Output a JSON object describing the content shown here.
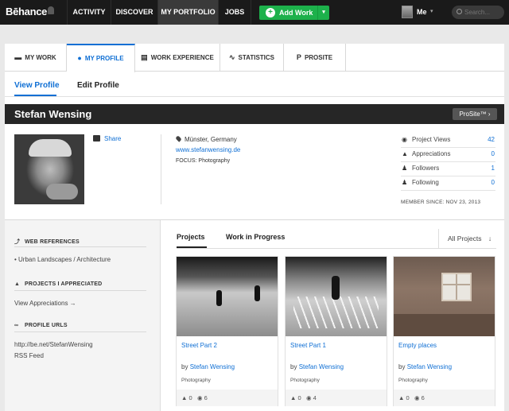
{
  "topnav": {
    "logo": "Bēhance",
    "items": [
      "ACTIVITY",
      "DISCOVER",
      "MY PORTFOLIO",
      "JOBS"
    ],
    "add_work": "Add Work",
    "user": "Me",
    "search_placeholder": "Search..."
  },
  "tabs": [
    {
      "label": "MY WORK",
      "icon": "briefcase-icon"
    },
    {
      "label": "MY PROFILE",
      "icon": "user-icon"
    },
    {
      "label": "WORK EXPERIENCE",
      "icon": "document-icon"
    },
    {
      "label": "STATISTICS",
      "icon": "pulse-icon"
    },
    {
      "label": "PROSITE",
      "icon": "p-icon"
    }
  ],
  "subtabs": [
    "View Profile",
    "Edit Profile"
  ],
  "profile": {
    "name": "Stefan Wensing",
    "prosite_button": "ProSite™ ›",
    "share": "Share",
    "location": "Münster, Germany",
    "website": "www.stefanwensing.de",
    "focus_label": "FOCUS:",
    "focus_value": "Photography"
  },
  "stats": [
    {
      "label": "Project Views",
      "value": "42",
      "icon": "eye-icon"
    },
    {
      "label": "Appreciations",
      "value": "0",
      "icon": "thumbs-up-icon"
    },
    {
      "label": "Followers",
      "value": "1",
      "icon": "followers-icon"
    },
    {
      "label": "Following",
      "value": "0",
      "icon": "following-icon"
    }
  ],
  "member_since": "MEMBER SINCE: NOV 23, 2013",
  "sidebar": {
    "web_refs_title": "WEB REFERENCES",
    "web_refs": [
      "Urban Landscapes / Architecture"
    ],
    "appreciated_title": "PROJECTS I APPRECIATED",
    "view_appreciations": "View Appreciations →",
    "profile_urls_title": "PROFILE URLS",
    "urls": [
      "http://be.net/StefanWensing",
      "RSS Feed"
    ]
  },
  "projects_tabs": [
    "Projects",
    "Work in Progress"
  ],
  "all_projects": "All Projects",
  "projects": [
    {
      "title": "Street Part 2",
      "by": "by",
      "author": "Stefan Wensing",
      "category": "Photography",
      "appreciations": "0",
      "views": "6"
    },
    {
      "title": "Street Part 1",
      "by": "by",
      "author": "Stefan Wensing",
      "category": "Photography",
      "appreciations": "0",
      "views": "4"
    },
    {
      "title": "Empty places",
      "by": "by",
      "author": "Stefan Wensing",
      "category": "Photography",
      "appreciations": "0",
      "views": "6"
    }
  ]
}
